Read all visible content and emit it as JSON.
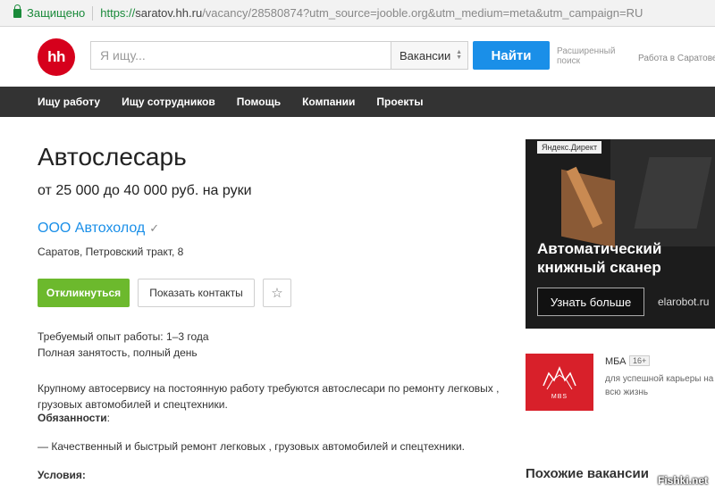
{
  "address_bar": {
    "secure_label": "Защищено",
    "url_scheme": "https://",
    "url_host": "saratov.hh.ru",
    "url_path": "/vacancy/28580874?utm_source=jooble.org&utm_medium=meta&utm_campaign=RU"
  },
  "header": {
    "logo_text": "hh",
    "search_placeholder": "Я ищу...",
    "search_type": "Вакансии",
    "search_button": "Найти",
    "advanced_search": "Расширенный поиск",
    "region": "Работа в Саратове"
  },
  "nav": {
    "items": [
      "Ищу работу",
      "Ищу сотрудников",
      "Помощь",
      "Компании",
      "Проекты"
    ]
  },
  "vacancy": {
    "title": "Автослесарь",
    "salary": "от 25 000 до 40 000 руб. на руки",
    "company": "ООО Автохолод",
    "address": "Саратов, Петровский тракт, 8",
    "respond_button": "Откликнуться",
    "contacts_button": "Показать контакты",
    "experience": "Требуемый опыт работы: 1–3 года",
    "employment": "Полная занятость, полный день",
    "description": "Крупному автосервису на постоянную работу требуются автослесари по ремонту легковых , грузовых автомобилей и спецтехники.",
    "responsibilities_heading": "Обязанности",
    "responsibilities_colon": ":",
    "duty_1": "—  Качественный и быстрый ремонт легковых , грузовых автомобилей и спецтехники.",
    "conditions_heading": "Условия:"
  },
  "ad": {
    "tag": "Яндекс.Директ",
    "title": "Автоматический книжный сканер",
    "button": "Узнать больше",
    "site": "elarobot.ru"
  },
  "mba_ad": {
    "logo_text": "MBS",
    "name": "МБА",
    "age": "16+",
    "description": "для успешной карьеры на всю жизнь"
  },
  "similar_heading": "Похожие вакансии",
  "watermark": "Fishki.net",
  "colors": {
    "brand_red": "#d6001c",
    "button_blue": "#1a8fe8",
    "respond_green": "#6cb92d",
    "nav_bg": "#333333",
    "annotation_arrow": "#e0392b"
  }
}
